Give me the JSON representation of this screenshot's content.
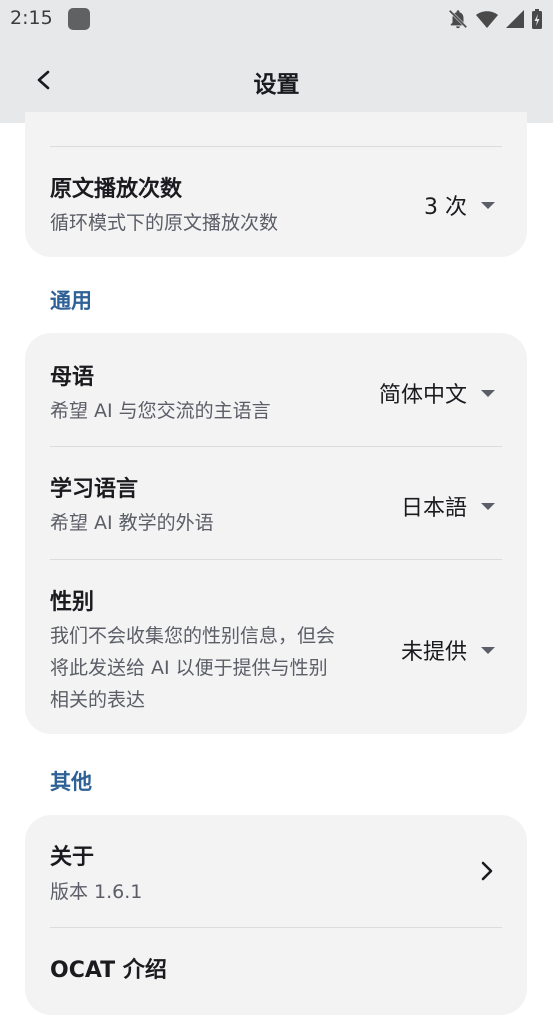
{
  "status": {
    "time": "2:15"
  },
  "appbar": {
    "title": "设置"
  },
  "playback": {
    "title": "原文播放次数",
    "subtitle": "循环模式下的原文播放次数",
    "value": "3 次"
  },
  "sections": {
    "general": "通用",
    "other": "其他"
  },
  "native_language": {
    "title": "母语",
    "subtitle": "希望 AI 与您交流的主语言",
    "value": "简体中文"
  },
  "learning_language": {
    "title": "学习语言",
    "subtitle": "希望 AI 教学的外语",
    "value": "日本語"
  },
  "gender": {
    "title": "性别",
    "subtitle_lines": [
      "我们不会收集您的性别信息，但会",
      "将此发送给 AI 以便于提供与性别",
      "相关的表达"
    ],
    "value": "未提供"
  },
  "about": {
    "title": "关于",
    "subtitle": "版本 1.6.1"
  },
  "ocat": {
    "title": "OCAT 介绍"
  },
  "colors": {
    "accent": "#2e6196",
    "card": "#f3f3f4",
    "bar": "#e6e8ea"
  }
}
